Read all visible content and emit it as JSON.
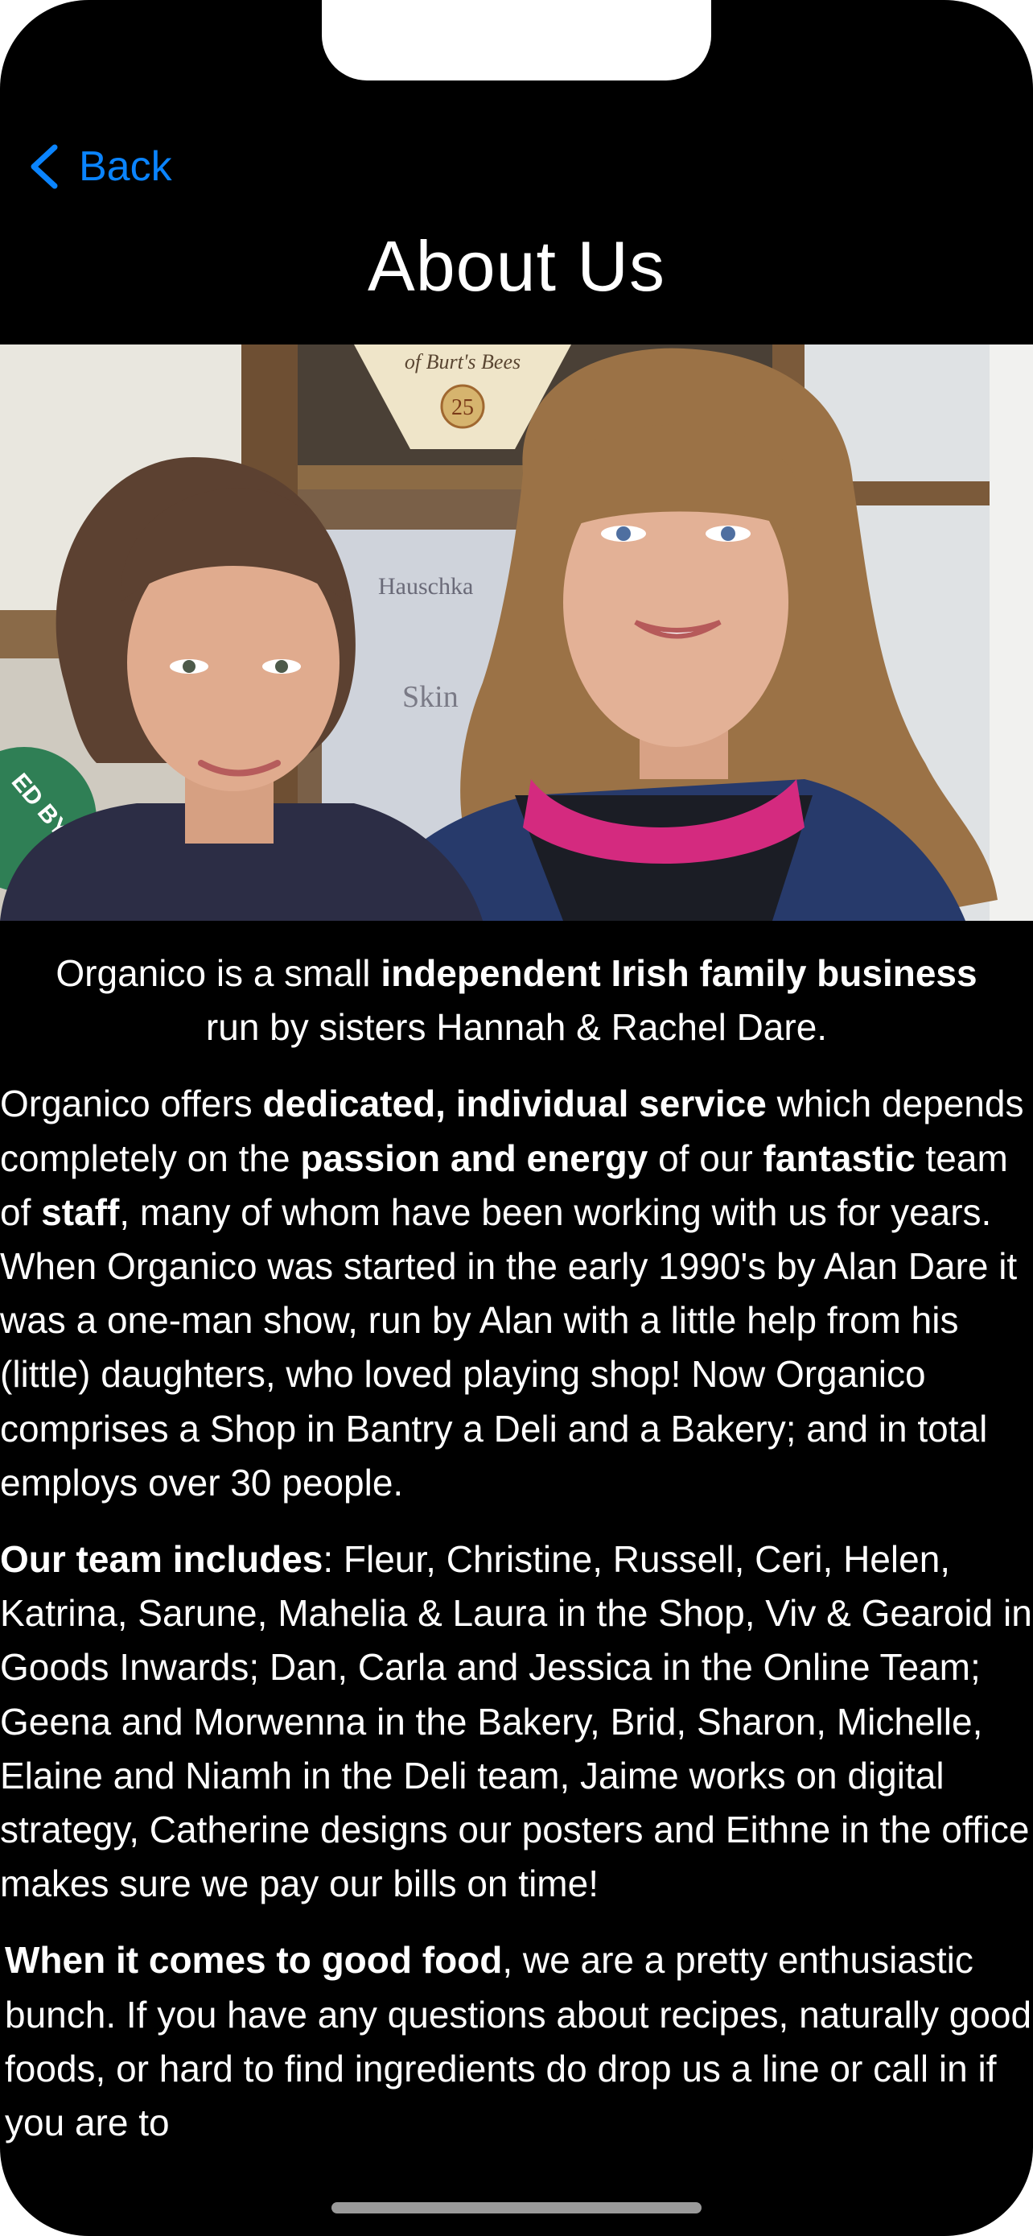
{
  "nav": {
    "back_label": "Back",
    "title": "About Us"
  },
  "intro": {
    "t1": "Organico is a small ",
    "b1": "independent Irish family business",
    "t2": " run by sisters Hannah & Rachel Dare."
  },
  "para1": {
    "t1": "Organico offers ",
    "b1": "dedicated, individual service",
    "t2": " which depends completely on the ",
    "b2": "passion and energy",
    "t3": " of our ",
    "b3": "fantastic",
    "t4": " team of ",
    "b4": "staff",
    "t5": ", many of whom have been working with us for years. When Organico was started in the early 1990's by Alan Dare it was a one-man show, run by Alan with a little help from his (little) daughters, who loved playing shop! Now Organico comprises a Shop in Bantry a Deli and a Bakery; and in total employs over 30 people."
  },
  "para2": {
    "b1": "Our team includes",
    "t1": ": Fleur, Christine, Russell, Ceri, Helen, Katrina, Sarune, Mahelia & Laura in the Shop, Viv & Gearoid in Goods Inwards; Dan, Carla and Jessica in the Online Team; Geena and Morwenna in the Bakery, Brid, Sharon, Michelle, Elaine and Niamh in the Deli team, Jaime works on digital strategy, Catherine designs our posters and Eithne in the office makes sure we pay our bills on time!"
  },
  "para3": {
    "b1": "When it comes to good food",
    "t1": ", we are a pretty enthusiastic bunch. If you have any questions about recipes, naturally good foods, or hard to find ingredients do drop us a line or call in if you are to"
  },
  "photo": {
    "sign_text": "of Burt's Bees",
    "badge_text": "25",
    "poster_text": "Hauschka",
    "poster_sub": "Skin",
    "sticker_text": "ED BY"
  },
  "colors": {
    "background": "#000000",
    "text": "#ffffff",
    "accent": "#0a84ff"
  },
  "icons": {
    "back": "chevron-left-icon"
  }
}
